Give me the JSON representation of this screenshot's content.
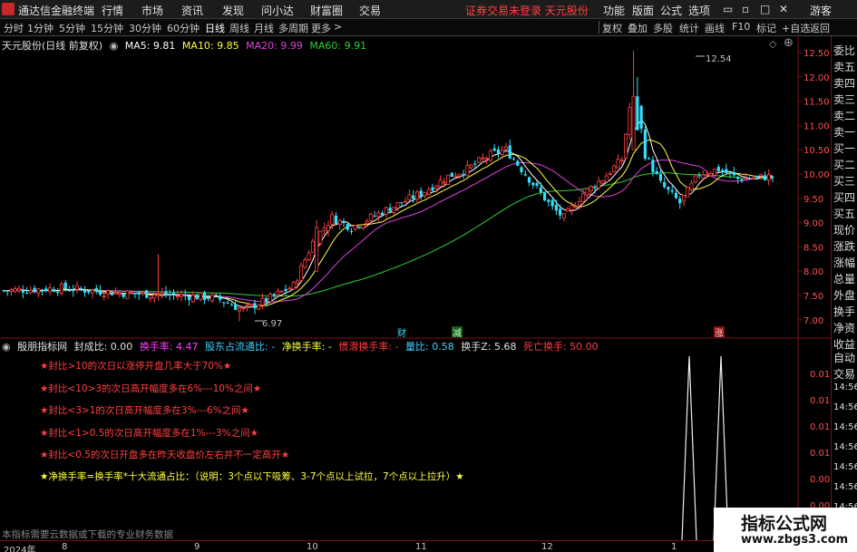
{
  "menubar": {
    "app_title": "通达信金融终端",
    "items": [
      "行情",
      "市场",
      "资讯",
      "发现",
      "问小达",
      "财富圈",
      "交易"
    ],
    "warning": "证券交易未登录 天元股份",
    "right_items": [
      "功能",
      "版面",
      "公式",
      "选项"
    ],
    "guest": "游客"
  },
  "toolbar": {
    "periods": [
      "分时",
      "1分钟",
      "5分钟",
      "15分钟",
      "30分钟",
      "60分钟",
      "日线",
      "周线",
      "月线",
      "多周期",
      "更多"
    ],
    "active_period": "日线",
    "right_buttons": [
      "复权",
      "叠加",
      "多股",
      "统计",
      "画线",
      "F10",
      "标记",
      "+自选",
      "返回"
    ]
  },
  "legend": {
    "stock": "天元股份(日线 前复权)",
    "ma5": "MA5: 9.81",
    "ma10": "MA10: 9.85",
    "ma20": "MA20: 9.99",
    "ma60": "MA60: 9.91"
  },
  "main_chart": {
    "high_label": "12.54",
    "low_label": "6.97",
    "markers": [
      "财",
      "减",
      "涨"
    ],
    "y_ticks": [
      "12.50",
      "12.00",
      "11.50",
      "11.00",
      "10.50",
      "10.00",
      "9.50",
      "9.00",
      "8.50",
      "8.00",
      "7.50",
      "7.00"
    ]
  },
  "right_panel": [
    "委比",
    "卖五",
    "卖四",
    "卖三",
    "卖二",
    "卖一",
    "买一",
    "买二",
    "买三",
    "买四",
    "买五",
    "现价",
    "涨跌",
    "涨幅",
    "总量",
    "外盘",
    "换手",
    "净资",
    "收益",
    "自动",
    "交易",
    "14:56",
    "14:56",
    "14:56",
    "14:56",
    "14:56",
    "14:56",
    "14:56",
    "14:56"
  ],
  "indicator": {
    "name": "殷朋指标网",
    "fengchengbi": "封成比: 0.00",
    "huanshou": "换手率: 4.47",
    "gudong": "股东占流通比: -",
    "jinghuanshou": "净换手率: -",
    "xiaohuanshou": "惯滑换手率: -",
    "liangbi": "量比: 0.58",
    "huanshouz": "换手Z: 5.68",
    "siwang": "死亡换手: 50.00",
    "y_ticks": [
      "0.01",
      "0.01",
      "0.01",
      "0.01",
      "0.00",
      "0.00"
    ],
    "notes": [
      "★封比>10的次日以涨停开盘几率大于70%★",
      "★封比<10>3的次日高开幅度多在6%---10%之间★",
      "★封比<3>1的次日高开幅度多在3%---6%之间★",
      "★封比<1>0.5的次日高开幅度多在1%---3%之间★",
      "★封比<0.5的次日开盘多在昨天收盘价左右并不一定高开★",
      "★净换手率=换手率*十大流通占比：（说明：3个点以下吸筹、3-7个点以上试拉，7个点以上拉升）★"
    ],
    "footer": "本指标需要云数据或下载的专业财务数据"
  },
  "xaxis": [
    "2024年",
    "8",
    "9",
    "10",
    "11",
    "12",
    "1"
  ],
  "watermark": {
    "line1": "指标公式网",
    "line2": "www.zbgs3.com"
  },
  "colors": {
    "up": "#ff4040",
    "down": "#33e0ff",
    "ma5": "#ffffff",
    "ma10": "#ffff40",
    "ma20": "#e040e0",
    "ma60": "#30d030"
  }
}
